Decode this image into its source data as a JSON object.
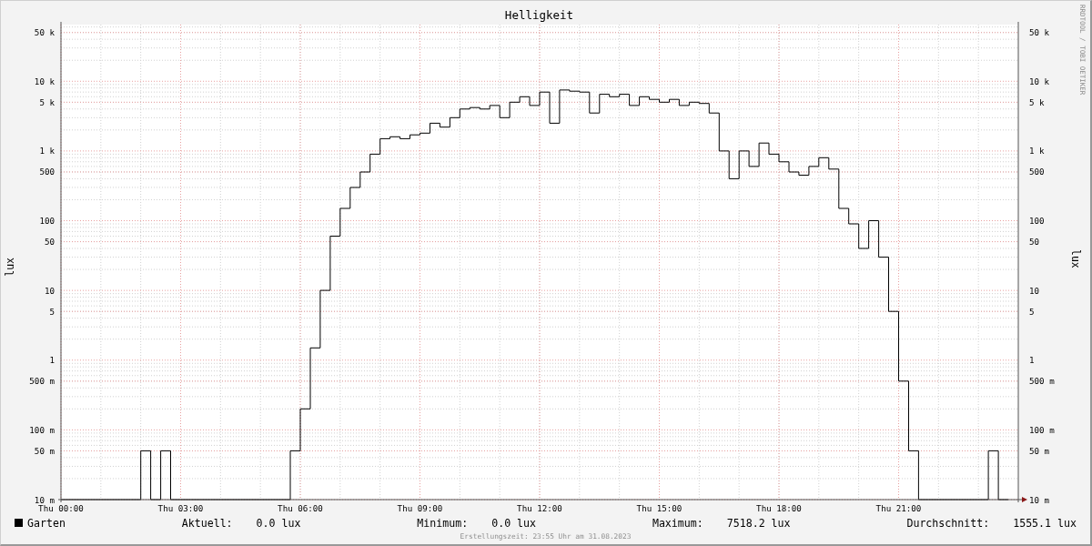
{
  "chart": {
    "title": "Helligkeit",
    "ylabel": "lux",
    "right_ylabel": "lux",
    "credit": "RRDTOOL / TOBI OETIKER",
    "left_y_tick_labels": [
      "50 k",
      "10 k",
      "5 k",
      "1 k",
      "500",
      "100",
      "50",
      "10",
      "5",
      "1",
      "500 m",
      "100 m",
      "50 m",
      "10 m"
    ],
    "right_y_tick_labels": [
      "50 k",
      "10 k",
      "5 k",
      "1 k",
      "500",
      "100",
      "50",
      "10",
      "5",
      "1",
      "500 m",
      "100 m",
      "50 m",
      "10 m"
    ],
    "x_tick_labels": [
      "Thu 00:00",
      "Thu 03:00",
      "Thu 06:00",
      "Thu 09:00",
      "Thu 12:00",
      "Thu 15:00",
      "Thu 18:00",
      "Thu 21:00"
    ],
    "legend": [
      {
        "name": "Garten",
        "color": "#000000"
      }
    ]
  },
  "stats": [
    {
      "label": "Aktuell:",
      "value": "0.0 lux"
    },
    {
      "label": "Minimum:",
      "value": "0.0 lux"
    },
    {
      "label": "Maximum:",
      "value": "7518.2 lux"
    },
    {
      "label": "Durchschnitt:",
      "value": "1555.1 lux"
    }
  ],
  "footer": "Erstellungszeit: 23:55 Uhr am 31.08.2023"
}
